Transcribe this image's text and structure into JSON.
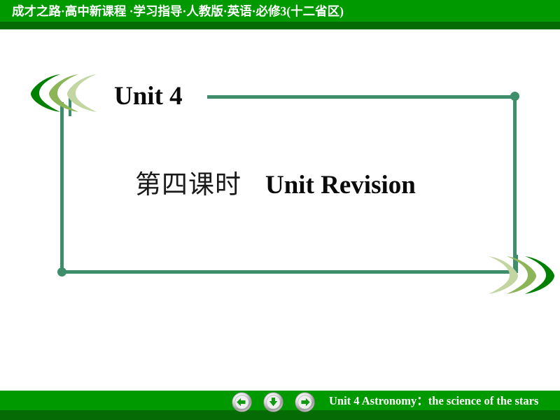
{
  "header": {
    "title": "成才之路·高中新课程 ·学习指导·人教版·英语·必修3(十二省区)",
    "bar_color": "#009900",
    "shadow_color": "#056b05",
    "text_color": "#ffffff"
  },
  "slide": {
    "unit_heading": "Unit 4",
    "lesson_number": "第四课时",
    "lesson_title": "Unit Revision",
    "frame_color": "#3e8d6b",
    "heading_color": "#0a0a0a"
  },
  "decoration": {
    "chevron_left": {
      "name": "left-pointing-chevron-cluster",
      "colors": [
        "#008000",
        "#8cb557",
        "#c3d6a1"
      ]
    },
    "chevron_right": {
      "name": "right-pointing-chevron-cluster",
      "colors": [
        "#c3d6a1",
        "#8cb557",
        "#008000"
      ]
    },
    "stem_color": "#3e8d6b"
  },
  "footer": {
    "text": "Unit 4    Astronomy：the science of the stars",
    "bar_color": "#009900",
    "shadow_color": "#056b05",
    "text_color": "#ffffff",
    "buttons": [
      {
        "name": "back-button",
        "icon": "arrow-left-icon",
        "label": "Back"
      },
      {
        "name": "down-button",
        "icon": "arrow-down-icon",
        "label": "Down"
      },
      {
        "name": "forward-button",
        "icon": "arrow-right-icon",
        "label": "Forward"
      }
    ],
    "button_arrow_color": "#129b12"
  }
}
